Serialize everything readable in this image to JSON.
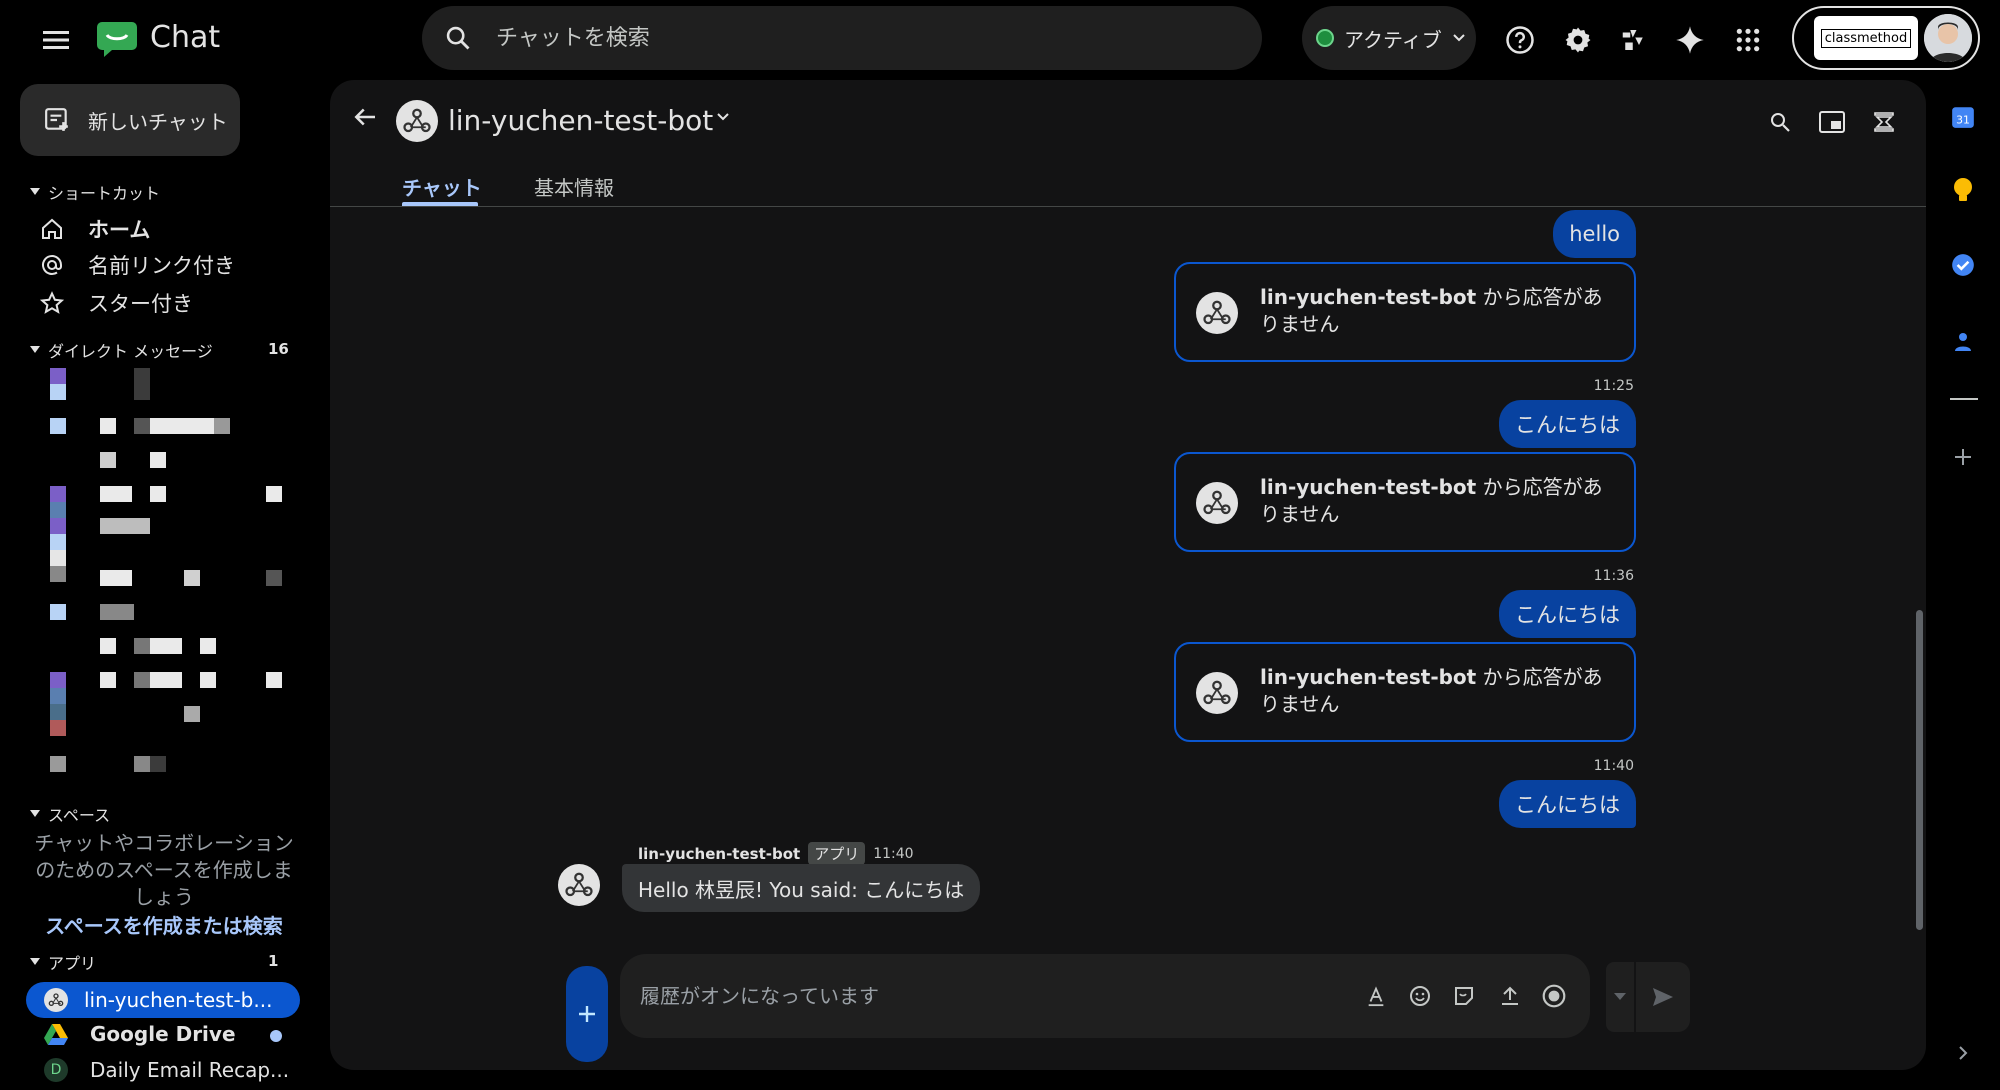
{
  "app": {
    "name": "Chat"
  },
  "search": {
    "placeholder": "チャットを検索"
  },
  "status": {
    "label": "アクティブ"
  },
  "account": {
    "org_logo_text": "classmethod"
  },
  "sidebar": {
    "new_chat_label": "新しいチャット",
    "shortcuts_title": "ショートカット",
    "shortcuts": [
      {
        "label": "ホーム",
        "icon": "home-icon"
      },
      {
        "label": "名前リンク付き",
        "icon": "at-icon"
      },
      {
        "label": "スター付き",
        "icon": "star-icon"
      }
    ],
    "dm_title": "ダイレクト メッセージ",
    "dm_count": "16",
    "spaces_title": "スペース",
    "spaces_empty_text": "チャットやコラボレーションのためのスペースを作成しましょう",
    "spaces_link": "スペースを作成または検索",
    "apps_title": "アプリ",
    "apps_count": "1",
    "apps": [
      {
        "label": "lin-yuchen-test-b..."
      },
      {
        "label": "Google Drive"
      },
      {
        "label": "Daily Email Recap..."
      }
    ]
  },
  "conversation": {
    "bot_name": "lin-yuchen-test-bot",
    "tabs": {
      "chat": "チャット",
      "info": "基本情報"
    },
    "messages": [
      {
        "type": "out",
        "text": "hello"
      },
      {
        "type": "bot_no_response",
        "bot": "lin-yuchen-test-bot",
        "suffix": " から応答がありません"
      },
      {
        "type": "time",
        "text": "11:25"
      },
      {
        "type": "out",
        "text": "こんにちは"
      },
      {
        "type": "bot_no_response",
        "bot": "lin-yuchen-test-bot",
        "suffix": " から応答がありません"
      },
      {
        "type": "time",
        "text": "11:36"
      },
      {
        "type": "out",
        "text": "こんにちは"
      },
      {
        "type": "bot_no_response",
        "bot": "lin-yuchen-test-bot",
        "suffix": " から応答がありません"
      },
      {
        "type": "time",
        "text": "11:40"
      },
      {
        "type": "out",
        "text": "こんにちは"
      }
    ],
    "reply": {
      "sender": "lin-yuchen-test-bot",
      "badge": "アプリ",
      "time": "11:40",
      "text": "Hello 林昱辰! You said: こんにちは"
    },
    "compose_placeholder": "履歴がオンになっています"
  },
  "colors": {
    "accent": "#a8c7fa",
    "outgoing_bubble": "#0842a0",
    "card_border": "#0b57d0",
    "active_status": "#1e8e3e"
  }
}
